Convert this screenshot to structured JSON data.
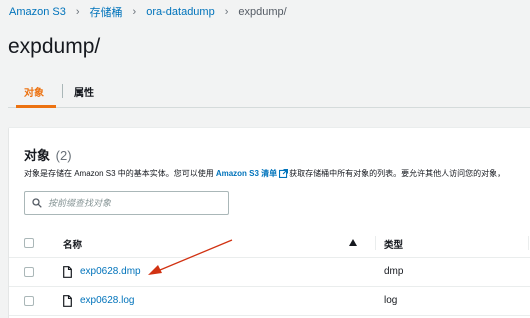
{
  "breadcrumb": {
    "items": [
      "Amazon S3",
      "存储桶",
      "ora-datadump"
    ],
    "current": "expdump/"
  },
  "page": {
    "title": "expdump/"
  },
  "tabs": [
    {
      "label": "对象",
      "active": true
    },
    {
      "label": "属性",
      "active": false
    }
  ],
  "objects_panel": {
    "title": "对象",
    "count": "(2)",
    "description_before": "对象是存储在 Amazon S3 中的基本实体。您可以使用",
    "description_link": "Amazon S3 清单",
    "description_after": "获取存储桶中所有对象的列表。要允许其他人访问您的对象，",
    "search": {
      "placeholder": "按前缀查找对象",
      "value": ""
    },
    "columns": {
      "name": "名称",
      "type": "类型"
    },
    "rows": [
      {
        "name": "exp0628.dmp",
        "type": "dmp"
      },
      {
        "name": "exp0628.log",
        "type": "log"
      }
    ]
  },
  "colors": {
    "link": "#0073bb",
    "accent": "#ec7211",
    "annotation_arrow": "#d13212"
  }
}
